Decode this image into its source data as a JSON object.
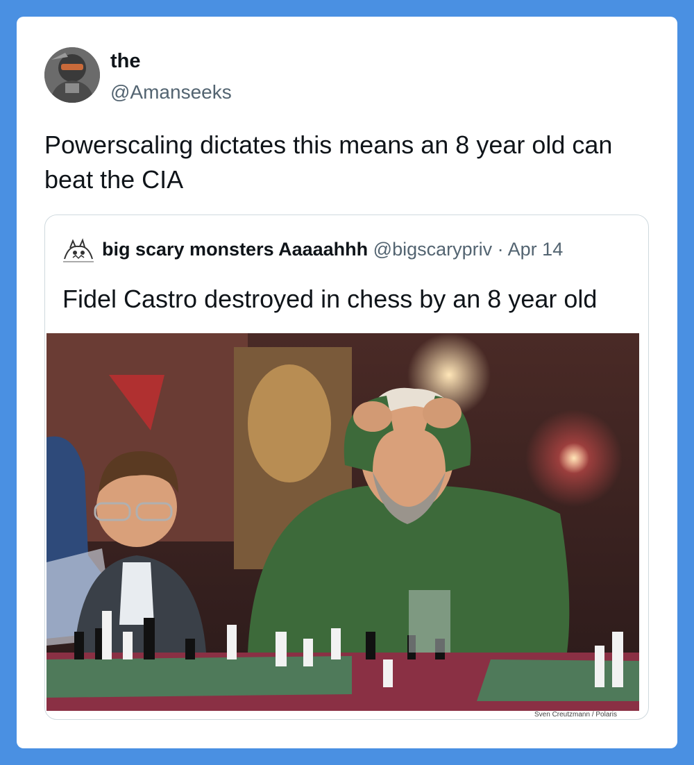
{
  "tweet": {
    "display_name": "the",
    "handle": "@Amanseeks",
    "text": "Powerscaling dictates this means an 8 year old can beat the CIA",
    "avatar_icon": "masked-figure-avatar"
  },
  "quoted_tweet": {
    "display_name": "big scary monsters Aaaaahhh",
    "handle": "@bigscarypriv",
    "separator": "·",
    "date": "Apr 14",
    "text": "Fidel Castro destroyed in chess by an 8 year old",
    "avatar_icon": "monster-sketch-avatar",
    "photo_credit": "Sven Creutzmann / Polaris"
  },
  "colors": {
    "background": "#4a90e2",
    "card": "#ffffff",
    "primary_text": "#0f1419",
    "secondary_text": "#536471",
    "quote_border": "#cfd9de"
  }
}
